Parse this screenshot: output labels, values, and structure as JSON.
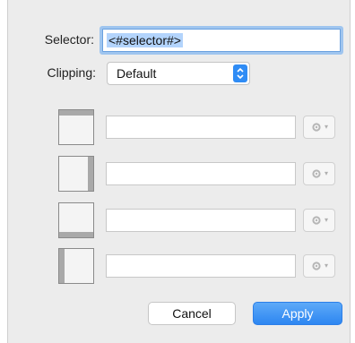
{
  "form": {
    "selector_label": "Selector:",
    "selector_value": "<#selector#>",
    "clipping_label": "Clipping:",
    "clipping_value": "Default"
  },
  "edges": [
    {
      "name": "top",
      "value": ""
    },
    {
      "name": "right",
      "value": ""
    },
    {
      "name": "bottom",
      "value": ""
    },
    {
      "name": "left",
      "value": ""
    }
  ],
  "buttons": {
    "cancel": "Cancel",
    "apply": "Apply"
  },
  "colors": {
    "accent": "#2f8cf5",
    "focus_ring": "#9fc5ef",
    "selection": "#b3d4fc"
  },
  "icons": {
    "popup": "up-down-chevron-icon",
    "action": "gear-icon"
  }
}
